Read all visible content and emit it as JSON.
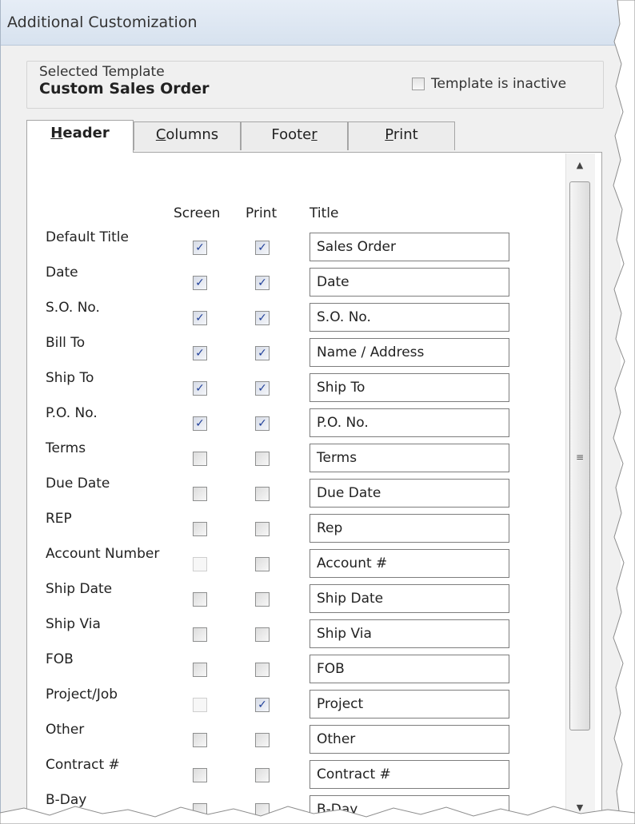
{
  "window": {
    "title": "Additional Customization"
  },
  "template_group": {
    "label": "Selected Template",
    "name": "Custom Sales Order",
    "inactive_label": "Template is inactive",
    "inactive_checked": false
  },
  "tabs": [
    {
      "prefix": "",
      "mnemonic": "H",
      "suffix": "eader",
      "active": true
    },
    {
      "prefix": "",
      "mnemonic": "C",
      "suffix": "olumns",
      "active": false
    },
    {
      "prefix": "Foote",
      "mnemonic": "r",
      "suffix": "",
      "active": false
    },
    {
      "prefix": "",
      "mnemonic": "P",
      "suffix": "rint",
      "active": false
    }
  ],
  "columns": {
    "screen": "Screen",
    "print": "Print",
    "title": "Title"
  },
  "rows": [
    {
      "label": "Default Title",
      "screen": "checked",
      "print": "checked",
      "title": "Sales Order"
    },
    {
      "label": "Date",
      "screen": "checked",
      "print": "checked",
      "title": "Date"
    },
    {
      "label": "S.O. No.",
      "screen": "checked",
      "print": "checked",
      "title": "S.O. No."
    },
    {
      "label": "Bill To",
      "screen": "checked",
      "print": "checked",
      "title": "Name / Address"
    },
    {
      "label": "Ship To",
      "screen": "checked",
      "print": "checked",
      "title": "Ship To"
    },
    {
      "label": "P.O. No.",
      "screen": "checked",
      "print": "checked",
      "title": "P.O. No."
    },
    {
      "label": "Terms",
      "screen": "unchecked",
      "print": "unchecked",
      "title": "Terms"
    },
    {
      "label": "Due Date",
      "screen": "unchecked",
      "print": "unchecked",
      "title": "Due Date"
    },
    {
      "label": "REP",
      "screen": "unchecked",
      "print": "unchecked",
      "title": "Rep"
    },
    {
      "label": "Account Number",
      "screen": "disabled",
      "print": "unchecked",
      "title": "Account #"
    },
    {
      "label": "Ship Date",
      "screen": "unchecked",
      "print": "unchecked",
      "title": "Ship Date"
    },
    {
      "label": "Ship Via",
      "screen": "unchecked",
      "print": "unchecked",
      "title": "Ship Via"
    },
    {
      "label": "FOB",
      "screen": "unchecked",
      "print": "unchecked",
      "title": "FOB"
    },
    {
      "label": "Project/Job",
      "screen": "disabled",
      "print": "checked",
      "title": "Project"
    },
    {
      "label": "Other",
      "screen": "unchecked",
      "print": "unchecked",
      "title": "Other"
    },
    {
      "label": "Contract #",
      "screen": "unchecked",
      "print": "unchecked",
      "title": "Contract #"
    },
    {
      "label": "B-Day",
      "screen": "unchecked",
      "print": "unchecked",
      "title": "B-Day"
    }
  ],
  "icons": {
    "scroll_up": "triangle-up",
    "scroll_down": "triangle-down",
    "scroll_grip": "grip-lines",
    "check": "checkmark"
  },
  "colors": {
    "titlebar": "#dce6f2",
    "check": "#21409a",
    "panel": "#ffffff"
  }
}
